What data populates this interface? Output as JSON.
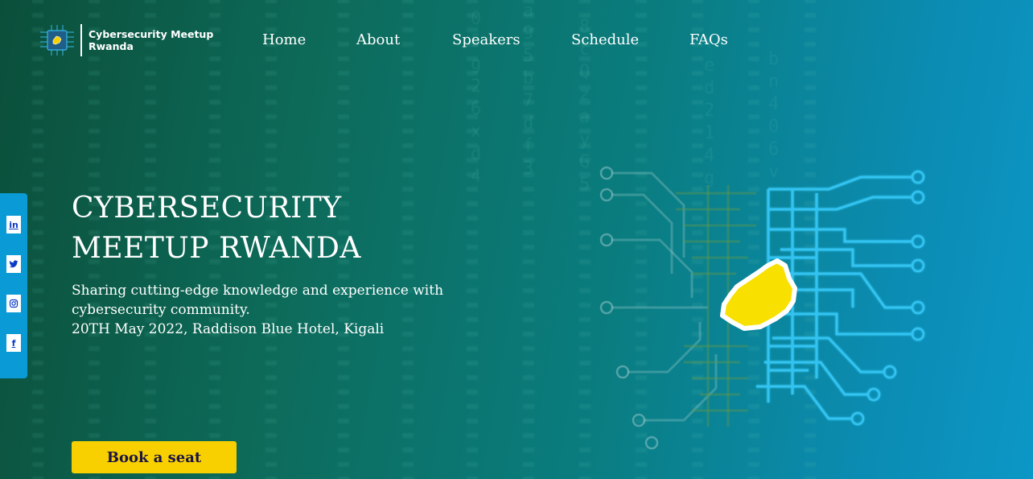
{
  "brand": {
    "name_line1": "Cybersecurity Meetup",
    "name_line2": "Rwanda",
    "logo_icon": "circuit-chip-rwanda-map-icon"
  },
  "nav": {
    "items": [
      {
        "label": "Home"
      },
      {
        "label": "About"
      },
      {
        "label": "Speakers"
      },
      {
        "label": "Schedule"
      },
      {
        "label": "FAQs"
      }
    ]
  },
  "social": {
    "items": [
      {
        "label": "in",
        "icon": "linkedin-icon"
      },
      {
        "label": "🐦",
        "icon": "twitter-icon"
      },
      {
        "label": "◎",
        "icon": "instagram-icon"
      },
      {
        "label": "f",
        "icon": "facebook-icon"
      }
    ]
  },
  "hero": {
    "title_line1": "CYBERSECURITY",
    "title_line2": "MEETUP RWANDA",
    "description": "Sharing cutting-edge knowledge and experience with cybersecurity community.",
    "date_venue": "20TH May 2022, Raddison Blue Hotel, Kigali",
    "cta_label": "Book a seat",
    "illustration_icon": "circuit-board-rwanda-map-icon"
  },
  "colors": {
    "accent_yellow": "#f8d000",
    "social_rail_blue": "#0a9bd6",
    "cta_text": "#1b1446",
    "circuit_blue": "#33c3f0"
  }
}
